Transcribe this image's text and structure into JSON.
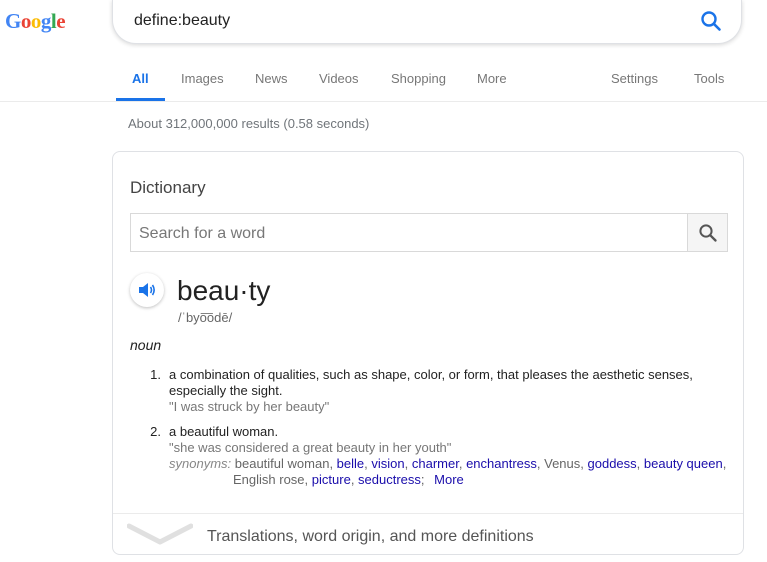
{
  "logo": {
    "letters": [
      "G",
      "o",
      "o",
      "g",
      "l",
      "e"
    ],
    "colors": [
      "#4285f4",
      "#ea4335",
      "#fbbc05",
      "#4285f4",
      "#34a853",
      "#ea4335"
    ]
  },
  "search": {
    "query": "define:beauty",
    "button_icon": "search-icon",
    "accent": "#1a73e8"
  },
  "tabs": {
    "items": [
      {
        "label": "All",
        "active": true
      },
      {
        "label": "Images"
      },
      {
        "label": "News"
      },
      {
        "label": "Videos"
      },
      {
        "label": "Shopping"
      },
      {
        "label": "More"
      },
      {
        "label": "Settings"
      },
      {
        "label": "Tools"
      }
    ]
  },
  "results": {
    "stats": "About 312,000,000 results (0.58 seconds)"
  },
  "dictionary": {
    "title": "Dictionary",
    "search_placeholder": "Search for a word",
    "audio_icon": "speaker-icon",
    "word": "beau·ty",
    "phonetic": "/ˈbyo͞odē/",
    "part_of_speech": "noun",
    "definitions": [
      {
        "number": "1.",
        "text": "a combination of qualities, such as shape, color, or form, that pleases the aesthetic senses, especially the sight.",
        "example": "\"I was struck by her beauty\""
      },
      {
        "number": "2.",
        "text": "a beautiful woman.",
        "example": "\"she was considered a great beauty in her youth\"",
        "synonyms_label": "synonyms:",
        "synonyms": [
          {
            "text": "beautiful woman",
            "link": false
          },
          {
            "text": "belle",
            "link": true
          },
          {
            "text": "vision",
            "link": true
          },
          {
            "text": "charmer",
            "link": true
          },
          {
            "text": "enchantress",
            "link": true
          },
          {
            "text": "Venus",
            "link": false
          },
          {
            "text": "goddess",
            "link": true
          },
          {
            "text": "beauty queen",
            "link": true
          },
          {
            "text": "English rose",
            "link": false
          },
          {
            "text": "picture",
            "link": true
          },
          {
            "text": "seductress",
            "link": true
          }
        ],
        "more_label": "More"
      }
    ],
    "footer_text": "Translations, word origin, and more definitions",
    "footer_icon": "chevron-down-icon"
  }
}
